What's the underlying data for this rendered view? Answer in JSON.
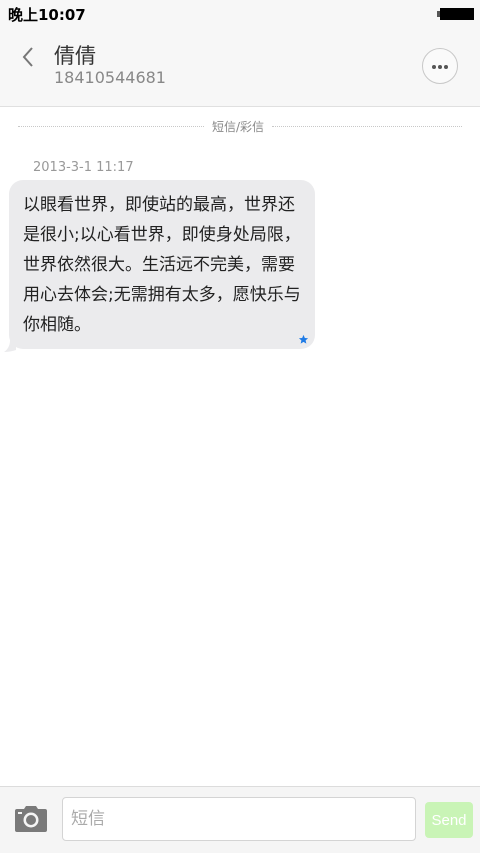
{
  "status_bar": {
    "time": "晚上10:07"
  },
  "header": {
    "back_icon": "chevron-left-icon",
    "contact_name": "倩倩",
    "contact_number": "18410544681",
    "more_icon": "more-horizontal-icon"
  },
  "thread": {
    "channel_label": "短信/彩信",
    "messages": [
      {
        "timestamp": "2013-3-1 11:17",
        "text": "以眼看世界，即使站的最高，世界还是很小;以心看世界，即使身处局限，世界依然很大。生活远不完美，需要用心去体会;无需拥有太多，愿快乐与你相随。",
        "marker_icon": "star-icon",
        "marker_color": "#1e7be6"
      }
    ]
  },
  "composer": {
    "camera_icon": "camera-icon",
    "placeholder": "短信",
    "send_label": "Send",
    "send_color": "#c9f4b6"
  }
}
